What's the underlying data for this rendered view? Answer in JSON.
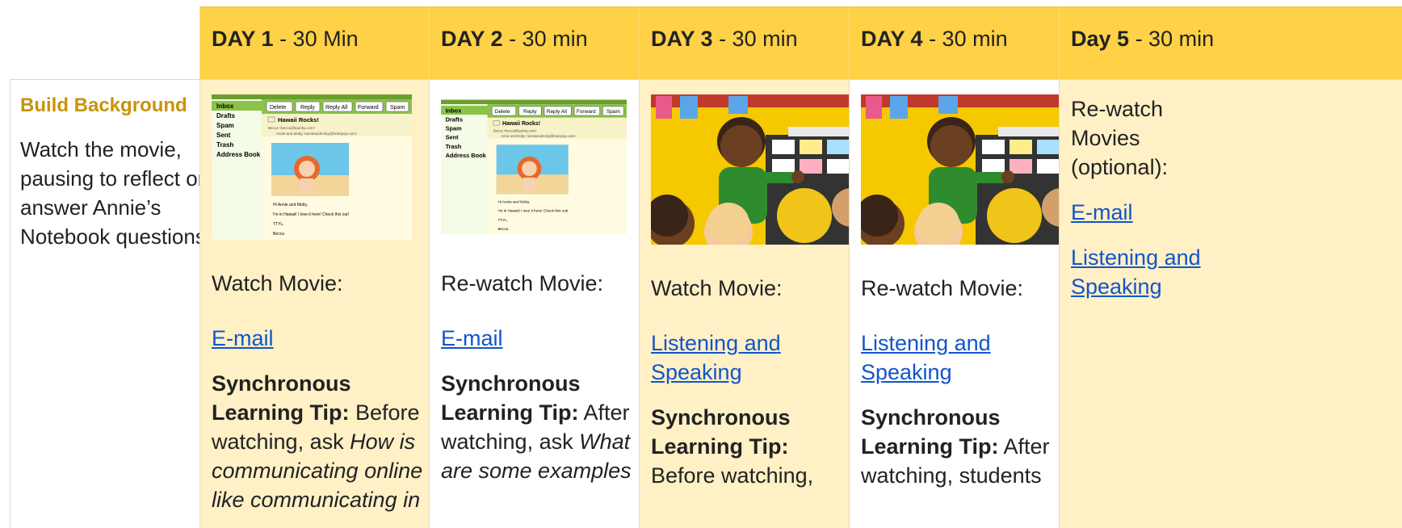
{
  "header": {
    "day1": {
      "bold": "DAY 1",
      "rest": " - 30 Min"
    },
    "day2": {
      "bold": "DAY 2",
      "rest": " - 30 min"
    },
    "day3": {
      "bold": "DAY 3",
      "rest": " - 30 min"
    },
    "day4": {
      "bold": "DAY 4",
      "rest": " - 30 min"
    },
    "day5": {
      "bold": "Day 5",
      "rest": " - 30 min"
    }
  },
  "row": {
    "title": "Build Background",
    "description": "Watch the movie, pausing to reflect or answer Annie’s Notebook questions."
  },
  "email_thumb": {
    "folders": [
      "Inbox",
      "Drafts",
      "Spam",
      "Sent",
      "Trash",
      "Address Book"
    ],
    "buttons": [
      "Delete",
      "Reply",
      "Reply All",
      "Forward",
      "Spam"
    ],
    "subject": "Hawaii Rocks!",
    "from": "Becca <becca@tpanky.com>",
    "to": "Annie and Moby <annieandmoby@brainpop.com>",
    "body": [
      "Hi Annie and Moby,",
      "I'm in Hawaii! I love it here! Check this out!",
      "TTYL,",
      "Becca"
    ]
  },
  "day1": {
    "label": "Watch Movie:",
    "link": "E-mail",
    "tip_bold": "Synchronous Learning Tip:",
    "tip_plain": " Before watching, ask ",
    "tip_italic": "How is communicating online like communicating in"
  },
  "day2": {
    "label": "Re-watch Movie:",
    "link": "E-mail",
    "tip_bold": "Synchronous Learning Tip:",
    "tip_plain": " After watching, ask ",
    "tip_italic": "What are some examples"
  },
  "day3": {
    "label": "Watch Movie:",
    "link": "Listening and Speaking",
    "tip_bold": "Synchronous Learning Tip:",
    "tip_plain": " Before watching,"
  },
  "day4": {
    "label": "Re-watch Movie:",
    "link": "Listening and Speaking",
    "tip_bold": "Synchronous Learning Tip:",
    "tip_plain": " After watching, students"
  },
  "day5": {
    "label": "Re-watch Movies (optional):",
    "link1": "E-mail",
    "link2": "Listening and Speaking"
  },
  "colors": {
    "header_yellow": "#ffd147",
    "cream": "#fff0c6",
    "title_gold": "#c9930b",
    "link_blue": "#1155cc"
  }
}
